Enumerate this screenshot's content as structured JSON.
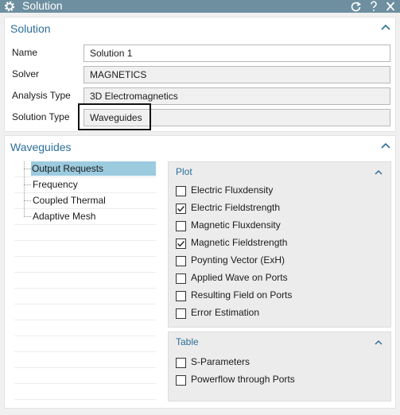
{
  "window": {
    "title": "Solution",
    "buttons": {
      "reset": "reset-icon",
      "help": "?",
      "close": "close-icon"
    }
  },
  "solution_group": {
    "title": "Solution",
    "fields": [
      {
        "label": "Name",
        "value": "Solution 1"
      },
      {
        "label": "Solver",
        "value": "MAGNETICS"
      },
      {
        "label": "Analysis Type",
        "value": "3D Electromagnetics"
      },
      {
        "label": "Solution Type",
        "value": "Waveguides"
      }
    ]
  },
  "waveguides_group": {
    "title": "Waveguides",
    "tree": [
      {
        "label": "Output Requests",
        "selected": true
      },
      {
        "label": "Frequency",
        "selected": false
      },
      {
        "label": "Coupled Thermal",
        "selected": false
      },
      {
        "label": "Adaptive Mesh",
        "selected": false
      }
    ],
    "plot": {
      "title": "Plot",
      "items": [
        {
          "label": "Electric Fluxdensity",
          "checked": false
        },
        {
          "label": "Electric Fieldstrength",
          "checked": true
        },
        {
          "label": "Magnetic Fluxdensity",
          "checked": false
        },
        {
          "label": "Magnetic Fieldstrength",
          "checked": true
        },
        {
          "label": "Poynting Vector (ExH)",
          "checked": false
        },
        {
          "label": "Applied Wave on Ports",
          "checked": false
        },
        {
          "label": "Resulting Field on Ports",
          "checked": false
        },
        {
          "label": "Error Estimation",
          "checked": false
        }
      ]
    },
    "table": {
      "title": "Table",
      "items": [
        {
          "label": "S-Parameters",
          "checked": false
        },
        {
          "label": "Powerflow through Ports",
          "checked": false
        }
      ]
    }
  },
  "colors": {
    "titlebar": "#6d8fa0",
    "accent": "#2b6f9a",
    "selection": "#9ccbe0",
    "panel": "#f0f0f0"
  }
}
